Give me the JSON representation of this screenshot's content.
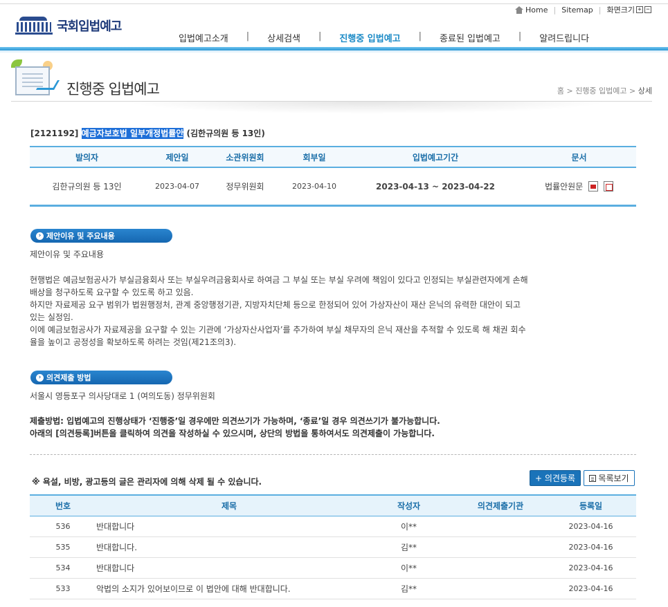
{
  "util": {
    "home": "Home",
    "sitemap": "Sitemap",
    "zoom_label": "화면크기",
    "zoom_in": "+",
    "zoom_out": "−"
  },
  "header": {
    "logo_text": "국회입법예고",
    "nav": [
      {
        "label": "입법예고소개"
      },
      {
        "label": "상세검색"
      },
      {
        "label": "진행중 입법예고",
        "active": true
      },
      {
        "label": "종료된 입법예고"
      },
      {
        "label": "알려드립니다"
      }
    ],
    "nav_sep": "|"
  },
  "page": {
    "title": "진행중 입법예고",
    "breadcrumb": [
      "홈",
      "진행중 입법예고",
      "상세"
    ],
    "bc_sep": ">"
  },
  "bill": {
    "number": "[2121192]",
    "name": "예금자보호법 일부개정법률안",
    "proposer_paren": "(김한규의원 등 13인)"
  },
  "info_table": {
    "headers": [
      "발의자",
      "제안일",
      "소관위원회",
      "회부일",
      "입법예고기간",
      "문서"
    ],
    "row": {
      "proposer": "김한규의원 등 13인",
      "proposed_date": "2023-04-07",
      "committee": "정무위원회",
      "referral_date": "2023-04-10",
      "period": "2023-04-13 ~ 2023-04-22",
      "document": "법률안원문"
    }
  },
  "section_reason": {
    "pill": "제안이유 및 주요내용",
    "subtitle": "제안이유 및 주요내용",
    "lines": [
      "현행법은 예금보험공사가 부실금융회사 또는 부실우려금융회사로 하여금 그 부실 또는 부실 우려에 책임이 있다고 인정되는 부실관련자에게 손해",
      "배상을 청구하도록 요구할 수 있도록 하고 있음.",
      "하지만 자료제공 요구 범위가 법원행정처, 관계 중앙행정기관, 지방자치단체 등으로 한정되어 있어 가상자산이 재산 은닉의 유력한 대안이 되고",
      "있는 실정임.",
      "이에 예금보험공사가 자료제공을 요구할 수 있는 기관에 ‘가상자산사업자’를 추가하여 부실 채무자의 은닉 재산을 추적할 수 있도록 해 채권 회수",
      "율을 높이고 공정성을 확보하도록 하려는 것임(제21조의3)."
    ]
  },
  "section_method": {
    "pill": "의견제출 방법",
    "address": "서울시 영등포구 의사당대로 1 (여의도동) 정무위원회",
    "note1": "제출방법: 입법예고의 진행상태가 ‘진행중’일 경우에만 의견쓰기가 가능하며, ‘종료’일 경우 의견쓰기가 불가능합니다.",
    "note2": "아래의 [의견등록]버튼을 클릭하여 의견을 작성하실 수 있으시며, 상단의 방법을 통하여서도 의견제출이 가능합니다."
  },
  "opinions": {
    "warning": "※ 욕설, 비방, 광고등의 글은 관리자에 의해 삭제 될 수 있습니다.",
    "add_button": "+ 의견등록",
    "list_button": "목록보기",
    "headers": [
      "번호",
      "제목",
      "작성자",
      "의견제출기관",
      "등록일"
    ],
    "rows": [
      {
        "no": "536",
        "title": "반대합니다",
        "author": "이**",
        "org": "",
        "date": "2023-04-16"
      },
      {
        "no": "535",
        "title": "반대합니다.",
        "author": "김**",
        "org": "",
        "date": "2023-04-16"
      },
      {
        "no": "534",
        "title": "반대합니다",
        "author": "이**",
        "org": "",
        "date": "2023-04-16"
      },
      {
        "no": "533",
        "title": "악법의 소지가 있어보이므로 이 법안에 대해 반대합니다.",
        "author": "김**",
        "org": "",
        "date": "2023-04-16"
      }
    ]
  }
}
